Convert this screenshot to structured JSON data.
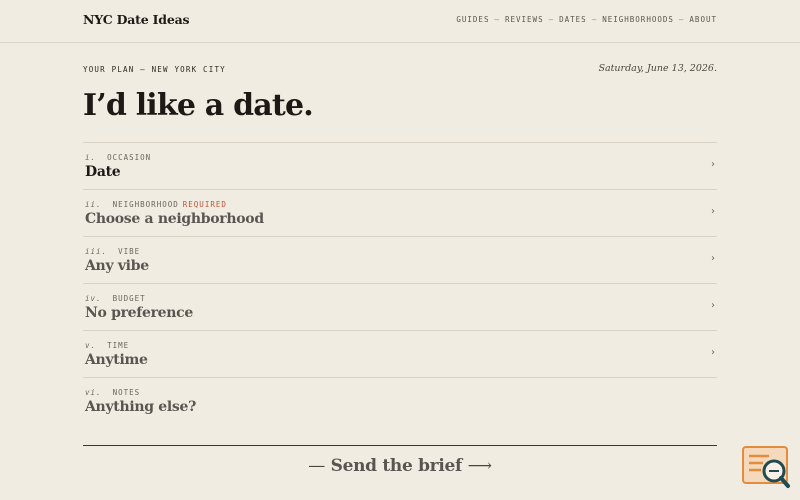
{
  "header": {
    "brand": "NYC Date Ideas",
    "nav": [
      {
        "label": "GUIDES"
      },
      {
        "label": "REVIEWS"
      },
      {
        "label": "DATES"
      },
      {
        "label": "NEIGHBORHOODS"
      },
      {
        "label": "ABOUT"
      }
    ],
    "separator": "—"
  },
  "plan": {
    "kicker": "YOUR PLAN — NEW YORK CITY",
    "date": "Saturday, June 13, 2026.",
    "headline": "I’d like a date."
  },
  "fields": [
    {
      "num": "i.",
      "label": "OCCASION",
      "required": "",
      "value": "Date",
      "chevron": "›"
    },
    {
      "num": "ii.",
      "label": "NEIGHBORHOOD",
      "required": "REQUIRED",
      "value": "Choose a neighborhood",
      "chevron": "›"
    },
    {
      "num": "iii.",
      "label": "VIBE",
      "required": "",
      "value": "Any vibe",
      "chevron": "›"
    },
    {
      "num": "iv.",
      "label": "BUDGET",
      "required": "",
      "value": "No preference",
      "chevron": "›"
    },
    {
      "num": "v.",
      "label": "TIME",
      "required": "",
      "value": "Anytime",
      "chevron": "›"
    },
    {
      "num": "vi.",
      "label": "NOTES",
      "required": "",
      "value": "Anything else?",
      "chevron": ""
    }
  ],
  "cta": {
    "left": "—",
    "label": "Send the brief",
    "right": "⟶"
  },
  "colors": {
    "background": "#f1ece2",
    "ink": "#1d1a16",
    "required": "#c0553a",
    "badge_orange": "#e58b3c",
    "badge_teal": "#1f4b52"
  },
  "icons": {
    "badge": "search-document-icon"
  }
}
